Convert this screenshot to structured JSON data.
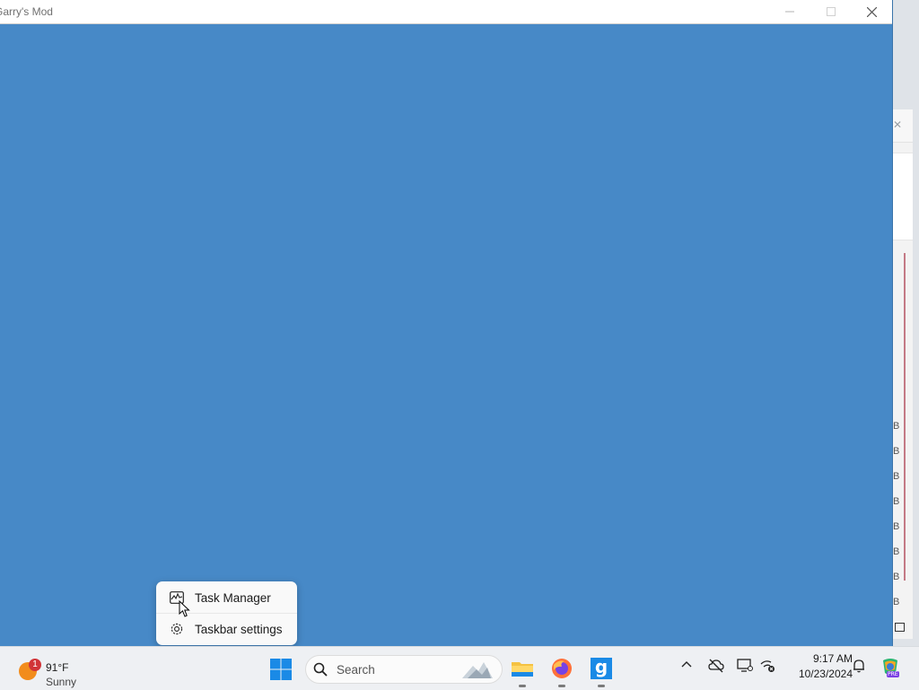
{
  "window": {
    "title": "Garry's Mod",
    "background_color": "#4789c7"
  },
  "background_window": {
    "tick_labels": [
      "B",
      "B",
      "B",
      "B",
      "B",
      "B",
      "B",
      "B"
    ]
  },
  "context_menu": {
    "items": [
      {
        "label": "Task Manager",
        "icon": "task-manager-icon"
      },
      {
        "label": "Taskbar settings",
        "icon": "gear-icon"
      }
    ]
  },
  "taskbar": {
    "weather": {
      "badge": "1",
      "temperature": "91°F",
      "condition": "Sunny"
    },
    "search_placeholder": "Search",
    "apps": [
      {
        "name": "file-explorer",
        "icon": "folder-icon"
      },
      {
        "name": "firefox",
        "icon": "firefox-icon"
      },
      {
        "name": "garrys-mod",
        "icon": "gmod-icon",
        "glyph": "g"
      }
    ],
    "clock": {
      "time": "9:17 AM",
      "date": "10/23/2024"
    },
    "tray_icons": [
      "chevron-up-icon",
      "onedrive-offline-icon",
      "display-icon",
      "network-disconnected-icon",
      "bell-icon",
      "copilot-icon"
    ],
    "copilot_badge": "PRE"
  },
  "colors": {
    "accent": "#0078d4",
    "badge_red": "#d13438"
  }
}
